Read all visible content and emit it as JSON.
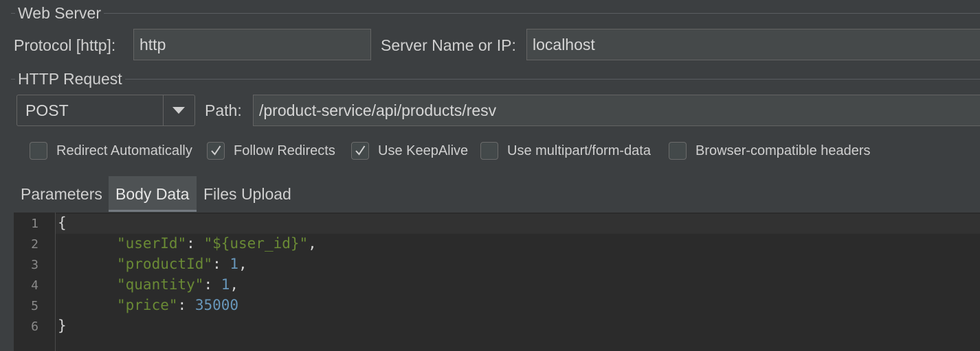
{
  "web_server": {
    "title": "Web Server",
    "protocol_label": "Protocol [http]:",
    "protocol_value": "http",
    "server_label": "Server Name or IP:",
    "server_value": "localhost"
  },
  "http_request": {
    "title": "HTTP Request",
    "method": "POST",
    "path_label": "Path:",
    "path_value": "/product-service/api/products/resv"
  },
  "options": [
    {
      "label": "Redirect Automatically",
      "checked": false
    },
    {
      "label": "Follow Redirects",
      "checked": true
    },
    {
      "label": "Use KeepAlive",
      "checked": true
    },
    {
      "label": "Use multipart/form-data",
      "checked": false
    },
    {
      "label": "Browser-compatible headers",
      "checked": false
    }
  ],
  "tabs": [
    {
      "label": "Parameters",
      "active": false
    },
    {
      "label": "Body Data",
      "active": true
    },
    {
      "label": "Files Upload",
      "active": false
    }
  ],
  "editor": {
    "line_numbers": [
      "1",
      "2",
      "3",
      "4",
      "5",
      "6"
    ],
    "lines": {
      "l1": {
        "text": "{"
      },
      "l2": {
        "key": "\"userId\"",
        "colon": ": ",
        "value": "\"${user_id}\"",
        "comma": ","
      },
      "l3": {
        "key": "\"productId\"",
        "colon": ": ",
        "value": "1",
        "comma": ","
      },
      "l4": {
        "key": "\"quantity\"",
        "colon": ": ",
        "value": "1",
        "comma": ","
      },
      "l5": {
        "key": "\"price\"",
        "colon": ": ",
        "value": "35000"
      },
      "l6": {
        "text": "}"
      }
    }
  },
  "colors": {
    "background": "#3c3f41",
    "editor_background": "#2b2b2b",
    "string": "#6a8a35",
    "number": "#6897bb"
  }
}
